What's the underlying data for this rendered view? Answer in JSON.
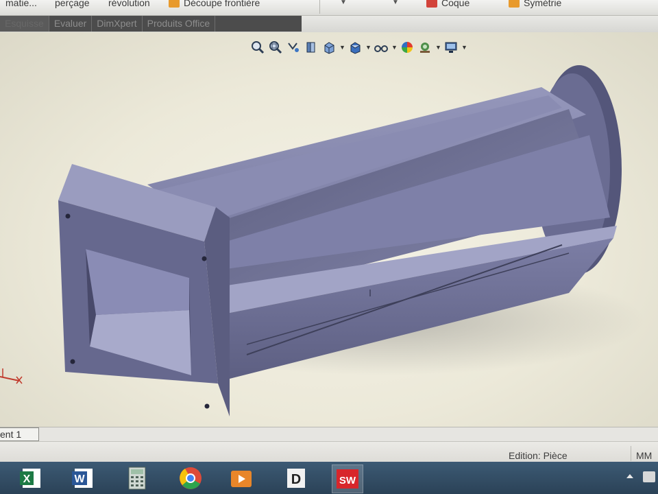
{
  "ribbon": {
    "items": [
      {
        "label": "matie..."
      },
      {
        "label": "perçage"
      },
      {
        "label": "révolution"
      },
      {
        "label": "Découpe frontière",
        "icon": "feature-icon"
      },
      {
        "label": "Coque",
        "icon": "shell-icon"
      },
      {
        "label": "Symétrie",
        "icon": "mirror-icon"
      }
    ]
  },
  "tabs": [
    {
      "label": "Esquisse"
    },
    {
      "label": "Evaluer"
    },
    {
      "label": "DimXpert"
    },
    {
      "label": "Produits Office"
    }
  ],
  "hud": {
    "icons": [
      "zoom-to-fit-icon",
      "zoom-to-area-icon",
      "previous-view-icon",
      "section-view-icon",
      "view-orientation-icon",
      "display-style-icon",
      "hide-show-items-icon",
      "edit-appearance-icon",
      "apply-scene-icon",
      "view-settings-icon"
    ]
  },
  "doc_tab": {
    "label": "ent 1"
  },
  "status": {
    "mode": "Edition: Pièce",
    "units": "MM"
  },
  "taskbar": {
    "apps": [
      {
        "name": "excel",
        "letter": "X",
        "color": "#1d7a45"
      },
      {
        "name": "word",
        "letter": "W",
        "color": "#2b5797"
      },
      {
        "name": "calculator",
        "letter": "",
        "color": "#5a7a6a"
      },
      {
        "name": "chrome",
        "letter": "",
        "color": "#dd4b39"
      },
      {
        "name": "media-player",
        "letter": "",
        "color": "#e8862a"
      },
      {
        "name": "draftsight",
        "letter": "D",
        "color": "#ffffff"
      },
      {
        "name": "solidworks",
        "letter": "SW",
        "color": "#d8262b"
      }
    ]
  },
  "colors": {
    "model_face": "#6e7196",
    "model_dark": "#4b4d6a",
    "viewport_bg": "#efedde"
  }
}
